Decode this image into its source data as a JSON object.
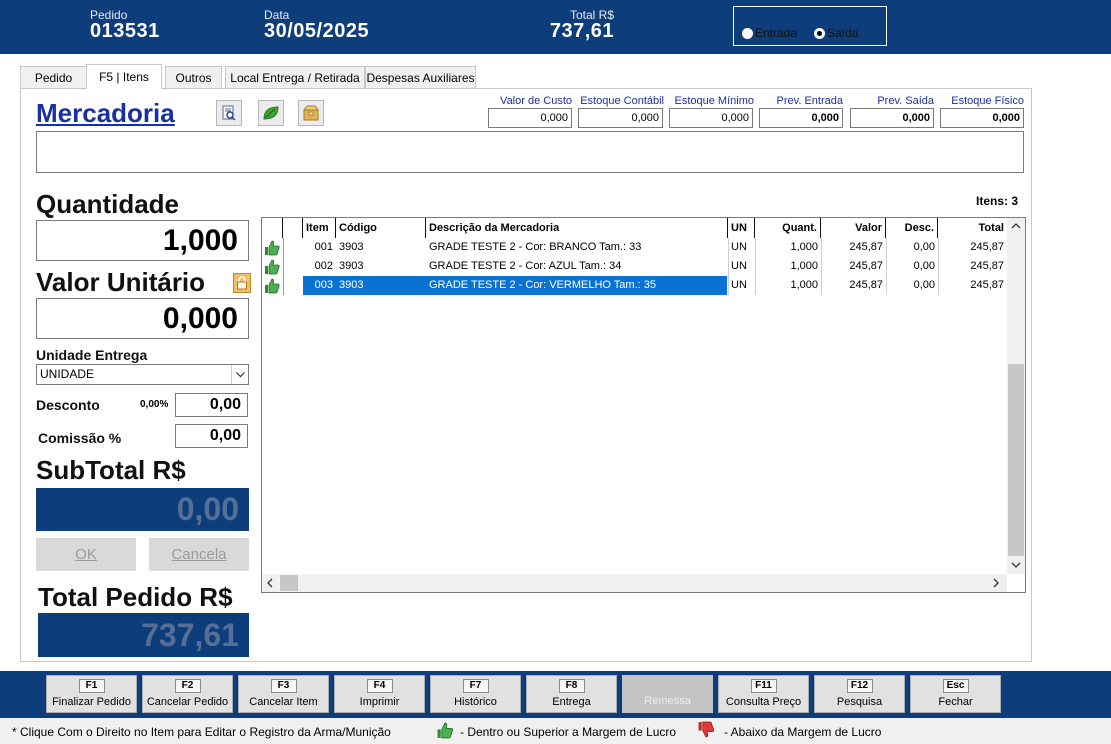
{
  "header": {
    "pedido_label": "Pedido",
    "pedido_value": "013531",
    "data_label": "Data",
    "data_value": "30/05/2025",
    "total_label": "Total R$",
    "total_value": "737,61",
    "mode_entrada": "Entrada",
    "mode_saida": "Saída",
    "mode_selected": "Saída"
  },
  "tabs": [
    "Pedido",
    "F5 | Itens",
    "Outros",
    "Local Entrega  / Retirada",
    "Despesas Auxiliares"
  ],
  "active_tab": "F5 | Itens",
  "mercadoria": {
    "title": "Mercadoria",
    "icons": [
      "document-search-icon",
      "leaf-icon",
      "box-icon"
    ]
  },
  "stock": {
    "valor_custo_label": "Valor de Custo",
    "valor_custo": "0,000",
    "estoque_contabil_label": "Estoque Contábil",
    "estoque_contabil": "0,000",
    "estoque_minimo_label": "Estoque Mínimo",
    "estoque_minimo": "0,000",
    "prev_entrada_label": "Prev. Entrada",
    "prev_entrada": "0,000",
    "prev_saida_label": "Prev. Saída",
    "prev_saida": "0,000",
    "estoque_fisico_label": "Estoque Físico",
    "estoque_fisico": "0,000"
  },
  "form": {
    "quantidade_label": "Quantidade",
    "quantidade_value": "1,000",
    "valor_unitario_label": "Valor Unitário",
    "valor_unitario_value": "0,000",
    "unidade_entrega_label": "Unidade Entrega",
    "unidade_entrega_value": "UNIDADE",
    "desconto_label": "Desconto",
    "desconto_pct": "0,00%",
    "desconto_value": "0,00",
    "comissao_label": "Comissão %",
    "comissao_value": "0,00",
    "subtotal_label": "SubTotal R$",
    "subtotal_value": "0,00",
    "ok_label": "OK",
    "cancela_label": "Cancela",
    "total_pedido_label": "Total Pedido R$",
    "total_pedido_value": "737,61"
  },
  "grid": {
    "itens_label": "Itens: 3",
    "columns": [
      "Item",
      "Código",
      "Descrição da Mercadoria",
      "UN",
      "Quant.",
      "Valor",
      "Desc.",
      "Total"
    ],
    "rows": [
      {
        "item": "001",
        "codigo": "3903",
        "descricao": "GRADE TESTE 2 - Cor: BRANCO Tam.: 33",
        "un": "UN",
        "quant": "1,000",
        "valor": "245,87",
        "desc": "0,00",
        "total": "245,87"
      },
      {
        "item": "002",
        "codigo": "3903",
        "descricao": "GRADE TESTE 2 - Cor: AZUL Tam.: 34",
        "un": "UN",
        "quant": "1,000",
        "valor": "245,87",
        "desc": "0,00",
        "total": "245,87"
      },
      {
        "item": "003",
        "codigo": "3903",
        "descricao": "GRADE TESTE 2 - Cor: VERMELHO Tam.: 35",
        "un": "UN",
        "quant": "1,000",
        "valor": "245,87",
        "desc": "0,00",
        "total": "245,87"
      }
    ],
    "selected_row": 2
  },
  "footer": {
    "buttons": [
      {
        "key": "F1",
        "label": "Finalizar Pedido"
      },
      {
        "key": "F2",
        "label": "Cancelar Pedido"
      },
      {
        "key": "F3",
        "label": "Cancelar Item"
      },
      {
        "key": "F4",
        "label": "Imprimir"
      },
      {
        "key": "F7",
        "label": "Histórico"
      },
      {
        "key": "F8",
        "label": "Entrega"
      },
      {
        "key": "",
        "label": "Remessa"
      },
      {
        "key": "F11",
        "label": "Consulta Preço"
      },
      {
        "key": "F12",
        "label": "Pesquisa"
      },
      {
        "key": "Esc",
        "label": "Fechar"
      }
    ]
  },
  "status": {
    "hint": "* Clique Com o Direito no Item para Editar o Registro da Arma/Munição",
    "legend_up": "- Dentro ou Superior a Margem de Lucro",
    "legend_down": "- Abaixo da Margem de Lucro"
  },
  "colors": {
    "header_bg": "#0d3d7a",
    "title_blue": "#1a2fa3",
    "selection_blue": "#0a73d1"
  }
}
